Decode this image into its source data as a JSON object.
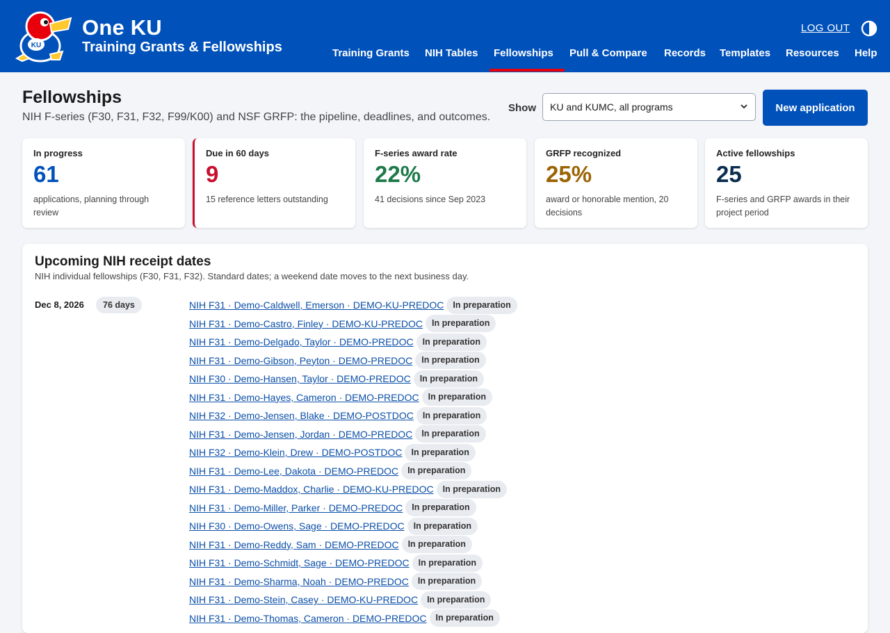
{
  "colors": {
    "brand_blue": "#0051ba",
    "accent_red": "#e8000d",
    "link_blue": "#0b4fa8",
    "stat_blue": "#0051ba",
    "stat_red": "#c8102e",
    "stat_green": "#1e7a4a",
    "stat_amber": "#9b6404",
    "stat_navy": "#0b2d50"
  },
  "header": {
    "title": "One KU",
    "subtitle": "Training Grants & Fellowships",
    "logo_icon": "jayhawk-logo",
    "logout_label": "LOG OUT",
    "contrast_icon": "contrast-toggle-icon",
    "nav": [
      {
        "label": "Training Grants"
      },
      {
        "label": "NIH Tables"
      },
      {
        "label": "Fellowships",
        "active": true
      },
      {
        "label": "Pull & Compare"
      },
      {
        "label": "Records"
      },
      {
        "label": "Templates"
      },
      {
        "label": "Resources"
      },
      {
        "label": "Help"
      }
    ]
  },
  "page": {
    "title": "Fellowships",
    "description": "NIH F-series (F30, F31, F32, F99/K00) and NSF GRFP: the pipeline, deadlines, and outcomes.",
    "show_label": "Show",
    "show_selected": "KU and KUMC, all programs",
    "new_button": "New application"
  },
  "stats": [
    {
      "label": "In progress",
      "value": "61",
      "note": "applications, planning through review"
    },
    {
      "label": "Due in 60 days",
      "value": "9",
      "note": "15 reference letters outstanding"
    },
    {
      "label": "F-series award rate",
      "value": "22%",
      "note": "41 decisions since Sep 2023"
    },
    {
      "label": "GRFP recognized",
      "value": "25%",
      "note": "award or honorable mention, 20 decisions"
    },
    {
      "label": "Active fellowships",
      "value": "25",
      "note": "F-series and GRFP awards in their project period"
    }
  ],
  "receipt": {
    "title": "Upcoming NIH receipt dates",
    "subtitle": "NIH individual fellowships (F30, F31, F32). Standard dates; a weekend date moves to the next business day.",
    "date": "Dec 8, 2026",
    "days": "76 days",
    "applications": [
      {
        "text": "NIH F31 · Demo-Caldwell, Emerson · DEMO-KU-PREDOC",
        "status": "In preparation"
      },
      {
        "text": "NIH F31 · Demo-Castro, Finley · DEMO-KU-PREDOC",
        "status": "In preparation"
      },
      {
        "text": "NIH F31 · Demo-Delgado, Taylor · DEMO-PREDOC",
        "status": "In preparation"
      },
      {
        "text": "NIH F31 · Demo-Gibson, Peyton · DEMO-PREDOC",
        "status": "In preparation"
      },
      {
        "text": "NIH F30 · Demo-Hansen, Taylor · DEMO-PREDOC",
        "status": "In preparation"
      },
      {
        "text": "NIH F31 · Demo-Hayes, Cameron · DEMO-PREDOC",
        "status": "In preparation"
      },
      {
        "text": "NIH F32 · Demo-Jensen, Blake · DEMO-POSTDOC",
        "status": "In preparation"
      },
      {
        "text": "NIH F31 · Demo-Jensen, Jordan · DEMO-PREDOC",
        "status": "In preparation"
      },
      {
        "text": "NIH F32 · Demo-Klein, Drew · DEMO-POSTDOC",
        "status": "In preparation"
      },
      {
        "text": "NIH F31 · Demo-Lee, Dakota · DEMO-PREDOC",
        "status": "In preparation"
      },
      {
        "text": "NIH F31 · Demo-Maddox, Charlie · DEMO-KU-PREDOC",
        "status": "In preparation"
      },
      {
        "text": "NIH F31 · Demo-Miller, Parker · DEMO-PREDOC",
        "status": "In preparation"
      },
      {
        "text": "NIH F30 · Demo-Owens, Sage · DEMO-PREDOC",
        "status": "In preparation"
      },
      {
        "text": "NIH F31 · Demo-Reddy, Sam · DEMO-PREDOC",
        "status": "In preparation"
      },
      {
        "text": "NIH F31 · Demo-Schmidt, Sage · DEMO-PREDOC",
        "status": "In preparation"
      },
      {
        "text": "NIH F31 · Demo-Sharma, Noah · DEMO-PREDOC",
        "status": "In preparation"
      },
      {
        "text": "NIH F31 · Demo-Stein, Casey · DEMO-KU-PREDOC",
        "status": "In preparation"
      },
      {
        "text": "NIH F31 · Demo-Thomas, Cameron · DEMO-PREDOC",
        "status": "In preparation"
      }
    ]
  }
}
